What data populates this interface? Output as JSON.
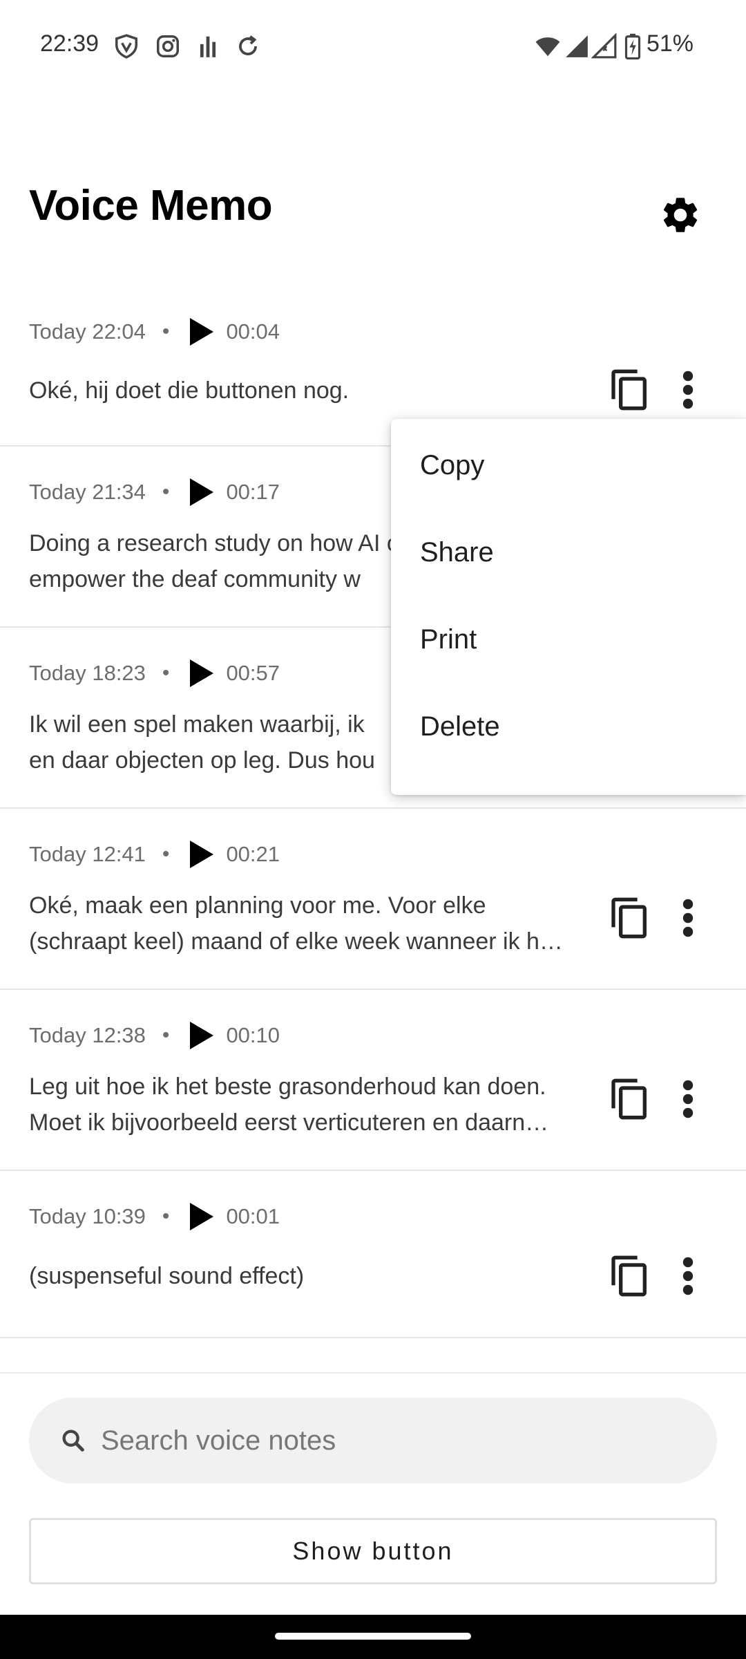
{
  "status_bar": {
    "time": "22:39",
    "left_icons": [
      "vpn-shield-icon",
      "instagram-icon",
      "audio-bars-icon",
      "sync-icon"
    ],
    "right_icons": [
      "wifi-icon",
      "signal-icon",
      "signal-empty-icon",
      "battery-charging-icon"
    ],
    "battery_percent": "51%"
  },
  "header": {
    "title": "Voice Memo",
    "settings_icon": "gear-icon"
  },
  "memos": [
    {
      "time": "Today 22:04",
      "separator": "•",
      "duration": "00:04",
      "lines": [
        "Oké, hij doet die buttonen nog."
      ]
    },
    {
      "time": "Today 21:34",
      "separator": "•",
      "duration": "00:17",
      "lines": [
        "Doing a research study on how AI can",
        "empower the deaf community w"
      ]
    },
    {
      "time": "Today 18:23",
      "separator": "•",
      "duration": "00:57",
      "lines": [
        "Ik wil een spel maken waarbij, ik",
        "en daar objecten op leg. Dus hou"
      ]
    },
    {
      "time": "Today 12:41",
      "separator": "•",
      "duration": "00:21",
      "lines": [
        "Oké, maak een planning voor me. Voor elke",
        "(schraapt keel) maand of elke week wanneer ik h…"
      ]
    },
    {
      "time": "Today 12:38",
      "separator": "•",
      "duration": "00:10",
      "lines": [
        "Leg uit hoe ik het beste grasonderhoud kan doen.",
        "Moet ik bijvoorbeeld eerst verticuteren en daarn…"
      ]
    },
    {
      "time": "Today 10:39",
      "separator": "•",
      "duration": "00:01",
      "lines": [
        "(suspenseful sound effect)"
      ]
    }
  ],
  "popup_menu": {
    "items": [
      "Copy",
      "Share",
      "Print",
      "Delete"
    ]
  },
  "search": {
    "placeholder": "Search voice notes",
    "value": ""
  },
  "show_button": {
    "label": "Show button"
  }
}
